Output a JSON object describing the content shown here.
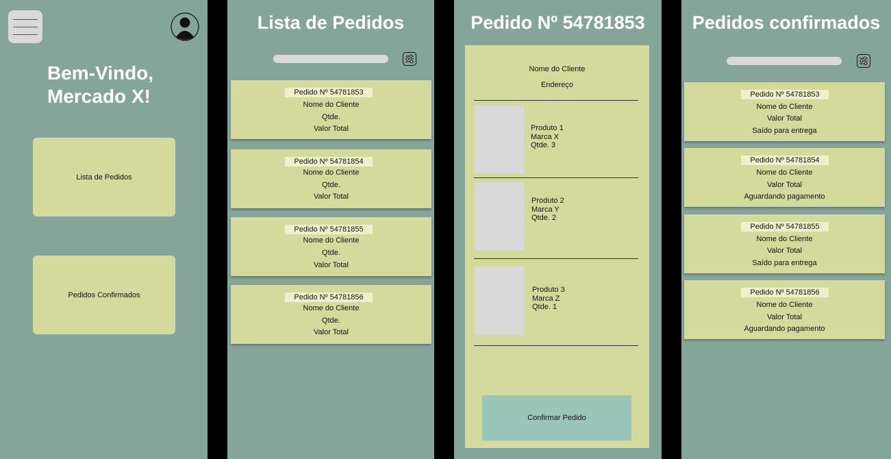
{
  "home": {
    "welcome_line1": "Bem-Vindo,",
    "welcome_line2": "Mercado X!",
    "btn_orders": "Lista de Pedidos",
    "btn_confirmed": "Pedidos Confirmados"
  },
  "orders": {
    "title": "Lista de Pedidos",
    "items": [
      {
        "id": "Pedido Nº 54781853",
        "client": "Nome do Cliente",
        "qty": "Qtde.",
        "total": "Valor Total"
      },
      {
        "id": "Pedido Nº 54781854",
        "client": "Nome do Cliente",
        "qty": "Qtde.",
        "total": "Valor Total"
      },
      {
        "id": "Pedido Nº 54781855",
        "client": "Nome do Cliente",
        "qty": "Qtde.",
        "total": "Valor Total"
      },
      {
        "id": "Pedido Nº 54781856",
        "client": "Nome do Cliente",
        "qty": "Qtde.",
        "total": "Valor Total"
      }
    ]
  },
  "detail": {
    "title": "Pedido Nº 54781853",
    "client": "Nome do Cliente",
    "address": "Endereço",
    "products": [
      {
        "name": "Produto 1",
        "brand": "Marca X",
        "qty": "Qtde. 3"
      },
      {
        "name": "Produto 2",
        "brand": "Marca Y",
        "qty": "Qtde. 2"
      },
      {
        "name": "Produto 3",
        "brand": "Marca Z",
        "qty": "Qtde. 1"
      }
    ],
    "confirm": "Confirmar Pedido"
  },
  "confirmed": {
    "title": "Pedidos confirmados",
    "items": [
      {
        "id": "Pedido Nº 54781853",
        "client": "Nome do Cliente",
        "total": "Valor Total",
        "status": "Saído para entrega"
      },
      {
        "id": "Pedido Nº 54781854",
        "client": "Nome do Cliente",
        "total": "Valor Total",
        "status": "Aguardando pagamento"
      },
      {
        "id": "Pedido Nº 54781855",
        "client": "Nome do Cliente",
        "total": "Valor Total",
        "status": "Saído para entrega"
      },
      {
        "id": "Pedido Nº 54781856",
        "client": "Nome do Cliente",
        "total": "Valor Total",
        "status": "Aguardando pagamento"
      }
    ]
  },
  "icons": {
    "menu": "hamburger-menu-icon",
    "avatar": "user-avatar-icon",
    "filter": "filter-sliders-icon"
  },
  "colors": {
    "screen_bg": "#85a59b",
    "card_bg": "#d4da9c",
    "confirm_btn": "#9ac6b9",
    "gutter": "#000000"
  }
}
